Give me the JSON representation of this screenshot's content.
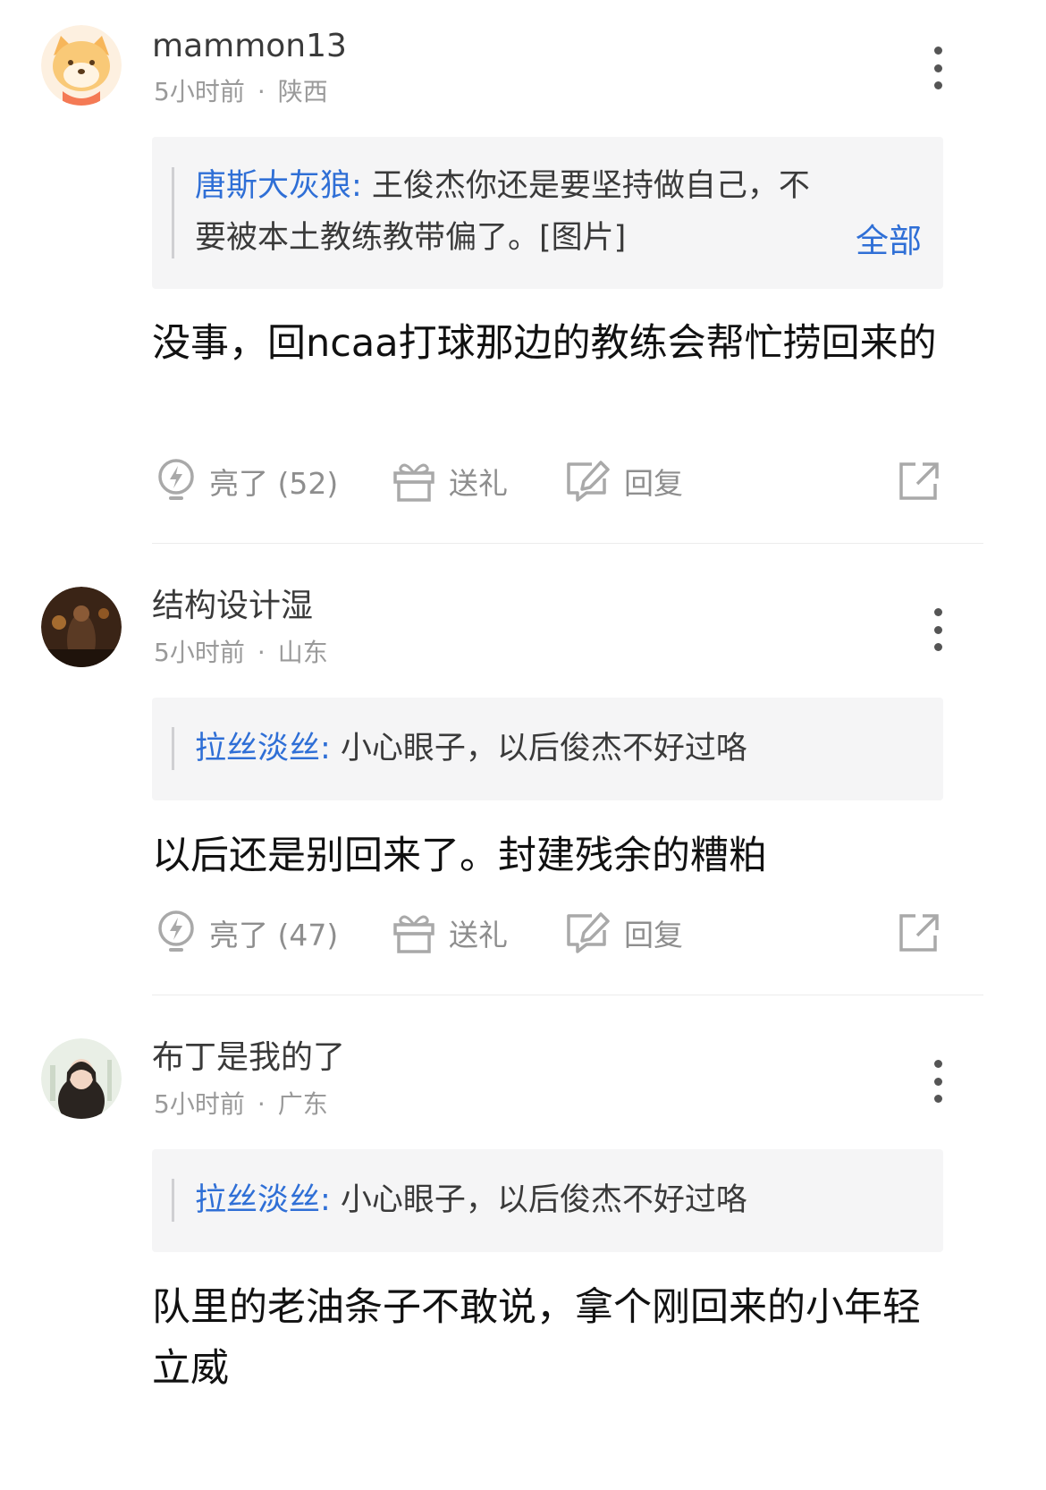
{
  "comments": [
    {
      "username": "mammon13",
      "time": "5小时前",
      "separator": "·",
      "location": "陕西",
      "quote": {
        "author": "唐斯大灰狼:",
        "text": " 王俊杰你还是要坚持做自己，不要被本土教练教带偏了。[图片]",
        "expand_label": "全部"
      },
      "body": "没事，回ncaa打球那边的教练会帮忙捞回来的",
      "actions": {
        "light": "亮了 (52)",
        "gift": "送礼",
        "reply": "回复"
      }
    },
    {
      "username": "结构设计湿",
      "time": "5小时前",
      "separator": "·",
      "location": "山东",
      "quote": {
        "author": "拉丝淡丝:",
        "text": " 小心眼子，以后俊杰不好过咯"
      },
      "body": "以后还是别回来了。封建残余的糟粕",
      "actions": {
        "light": "亮了 (47)",
        "gift": "送礼",
        "reply": "回复"
      }
    },
    {
      "username": "布丁是我的了",
      "time": "5小时前",
      "separator": "·",
      "location": "广东",
      "quote": {
        "author": "拉丝淡丝:",
        "text": " 小心眼子，以后俊杰不好过咯"
      },
      "body": "队里的老油条子不敢说，拿个刚回来的小年轻立威"
    }
  ],
  "icons": {
    "light": "lightbulb-bolt-icon",
    "gift": "gift-icon",
    "reply": "reply-edit-icon",
    "share": "share-icon",
    "more": "more-vertical-icon"
  },
  "colors": {
    "link": "#2f6fd6",
    "quote_bg": "#f5f5f6",
    "muted": "#9a9a9a"
  }
}
